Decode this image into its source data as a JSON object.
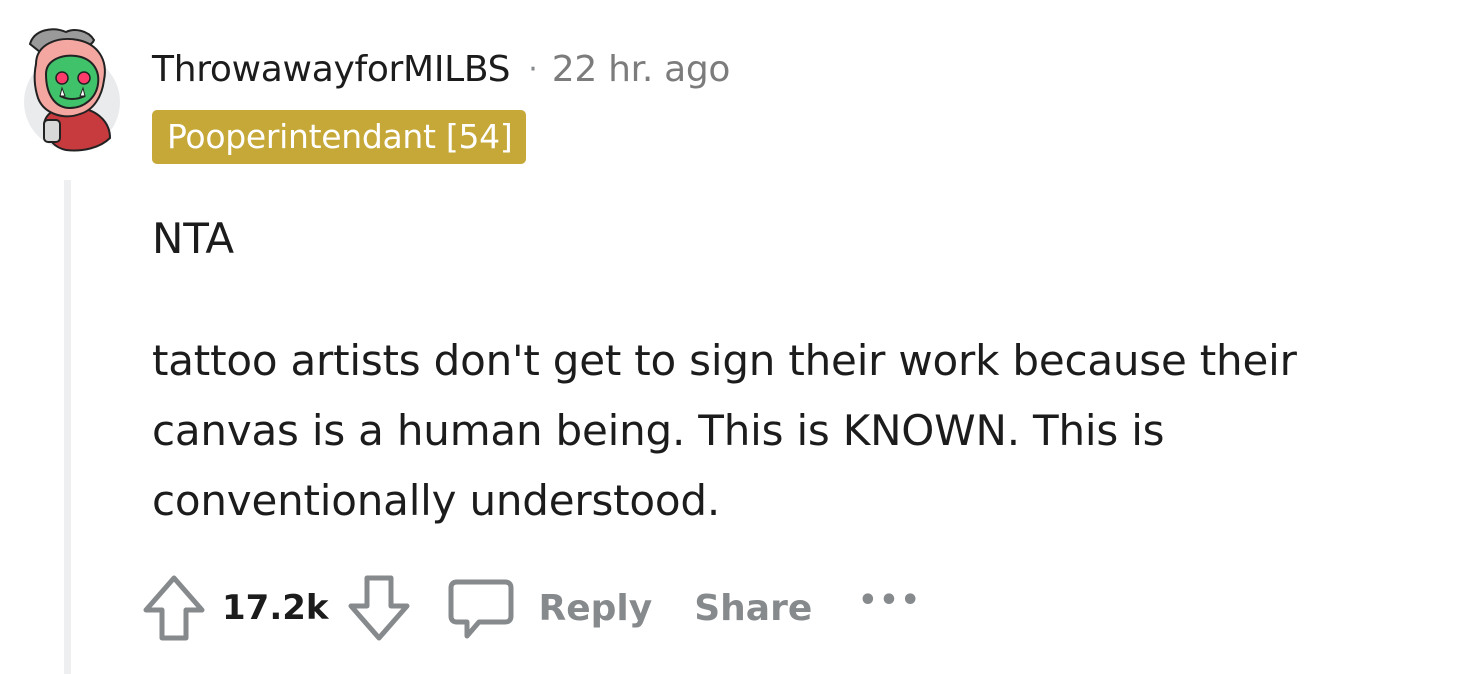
{
  "comment": {
    "username": "ThrowawayforMILBS",
    "separator": "·",
    "timestamp": "22 hr. ago",
    "flair": "Pooperintendant [54]",
    "paragraphs": [
      "NTA",
      "tattoo artists don't get to sign their work because their canvas is a human being. This is KNOWN. This is conventionally understood."
    ],
    "vote_count": "17.2k",
    "reply_label": "Reply",
    "share_label": "Share",
    "more_label": "•••"
  },
  "colors": {
    "flair_bg": "#c5a837",
    "action_gray": "#878a8c",
    "thread_line": "#edeff1",
    "avatar_skin": "#3fc26a",
    "avatar_hood": "#f4a7a0"
  },
  "icons": {
    "avatar": "avatar-goblin-icon",
    "upvote": "upvote-arrow-icon",
    "downvote": "downvote-arrow-icon",
    "reply": "comment-bubble-icon"
  }
}
